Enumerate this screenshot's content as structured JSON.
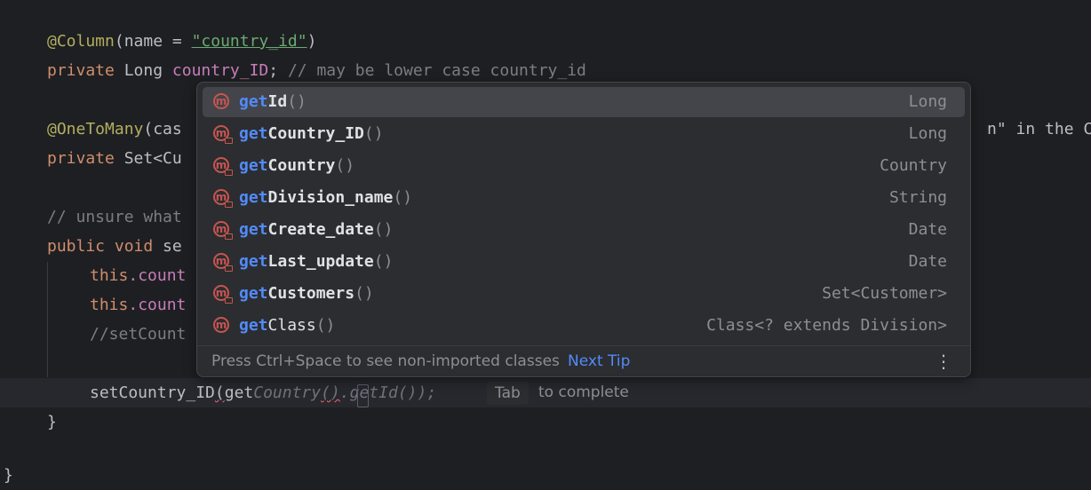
{
  "editor": {
    "lines": {
      "l1_ann": "@Column",
      "l1_a": "(name = ",
      "l1_str": "\"country_id\"",
      "l1_b": ")",
      "l2_kw": "private",
      "l2_a": " Long ",
      "l2_fld": "country_ID",
      "l2_b": "; ",
      "l2_cmt": "// may be lower case country_id",
      "l4_ann": "@OneToMany",
      "l4_a": "(cas",
      "l4_tail": "n\" in the Cu",
      "l5_kw": "private",
      "l5_a": " Set<Cu",
      "l7_cmt": "// unsure what",
      "l8_kw": "public void",
      "l8_a": " se",
      "l9_kw": "this",
      "l9_fld": ".count",
      "l10_kw": "this",
      "l10_fld": ".count",
      "l11_cmt": "//setCount",
      "l13_a": "setCountry_ID",
      "l13_b": "(",
      "l13_c": "get",
      "l13_ghost1": "Country",
      "l13_ghost2": "()",
      "l13_ghost3": ".getId());",
      "l14": "}",
      "l16": "}"
    },
    "inline_hint": {
      "key": "Tab",
      "text": "to complete"
    }
  },
  "completion": {
    "items": [
      {
        "prefix": "get",
        "rest": "Id",
        "parens": "()",
        "type": "Long",
        "selected": true,
        "icon": "method-icon"
      },
      {
        "prefix": "get",
        "rest": "Country_ID",
        "parens": "()",
        "type": "Long",
        "icon": "method-icon"
      },
      {
        "prefix": "get",
        "rest": "Country",
        "parens": "()",
        "type": "Country",
        "icon": "method-icon"
      },
      {
        "prefix": "get",
        "rest": "Division_name",
        "parens": "()",
        "type": "String",
        "icon": "method-icon"
      },
      {
        "prefix": "get",
        "rest": "Create_date",
        "parens": "()",
        "type": "Date",
        "icon": "method-icon"
      },
      {
        "prefix": "get",
        "rest": "Last_update",
        "parens": "()",
        "type": "Date",
        "icon": "method-icon"
      },
      {
        "prefix": "get",
        "rest": "Customers",
        "parens": "()",
        "type": "Set<Customer>",
        "icon": "method-icon"
      },
      {
        "prefix": "get",
        "rest": "Class",
        "parens": "()",
        "type": "Class<? extends Division>",
        "icon": "method-icon"
      }
    ],
    "footer": {
      "text": "Press Ctrl+Space to see non-imported classes",
      "link": "Next Tip",
      "more": "⋮"
    }
  },
  "colors": {
    "background": "#1e1f22",
    "popup": "#2b2d30",
    "accent": "#548af7",
    "method_icon": "#c75450"
  }
}
